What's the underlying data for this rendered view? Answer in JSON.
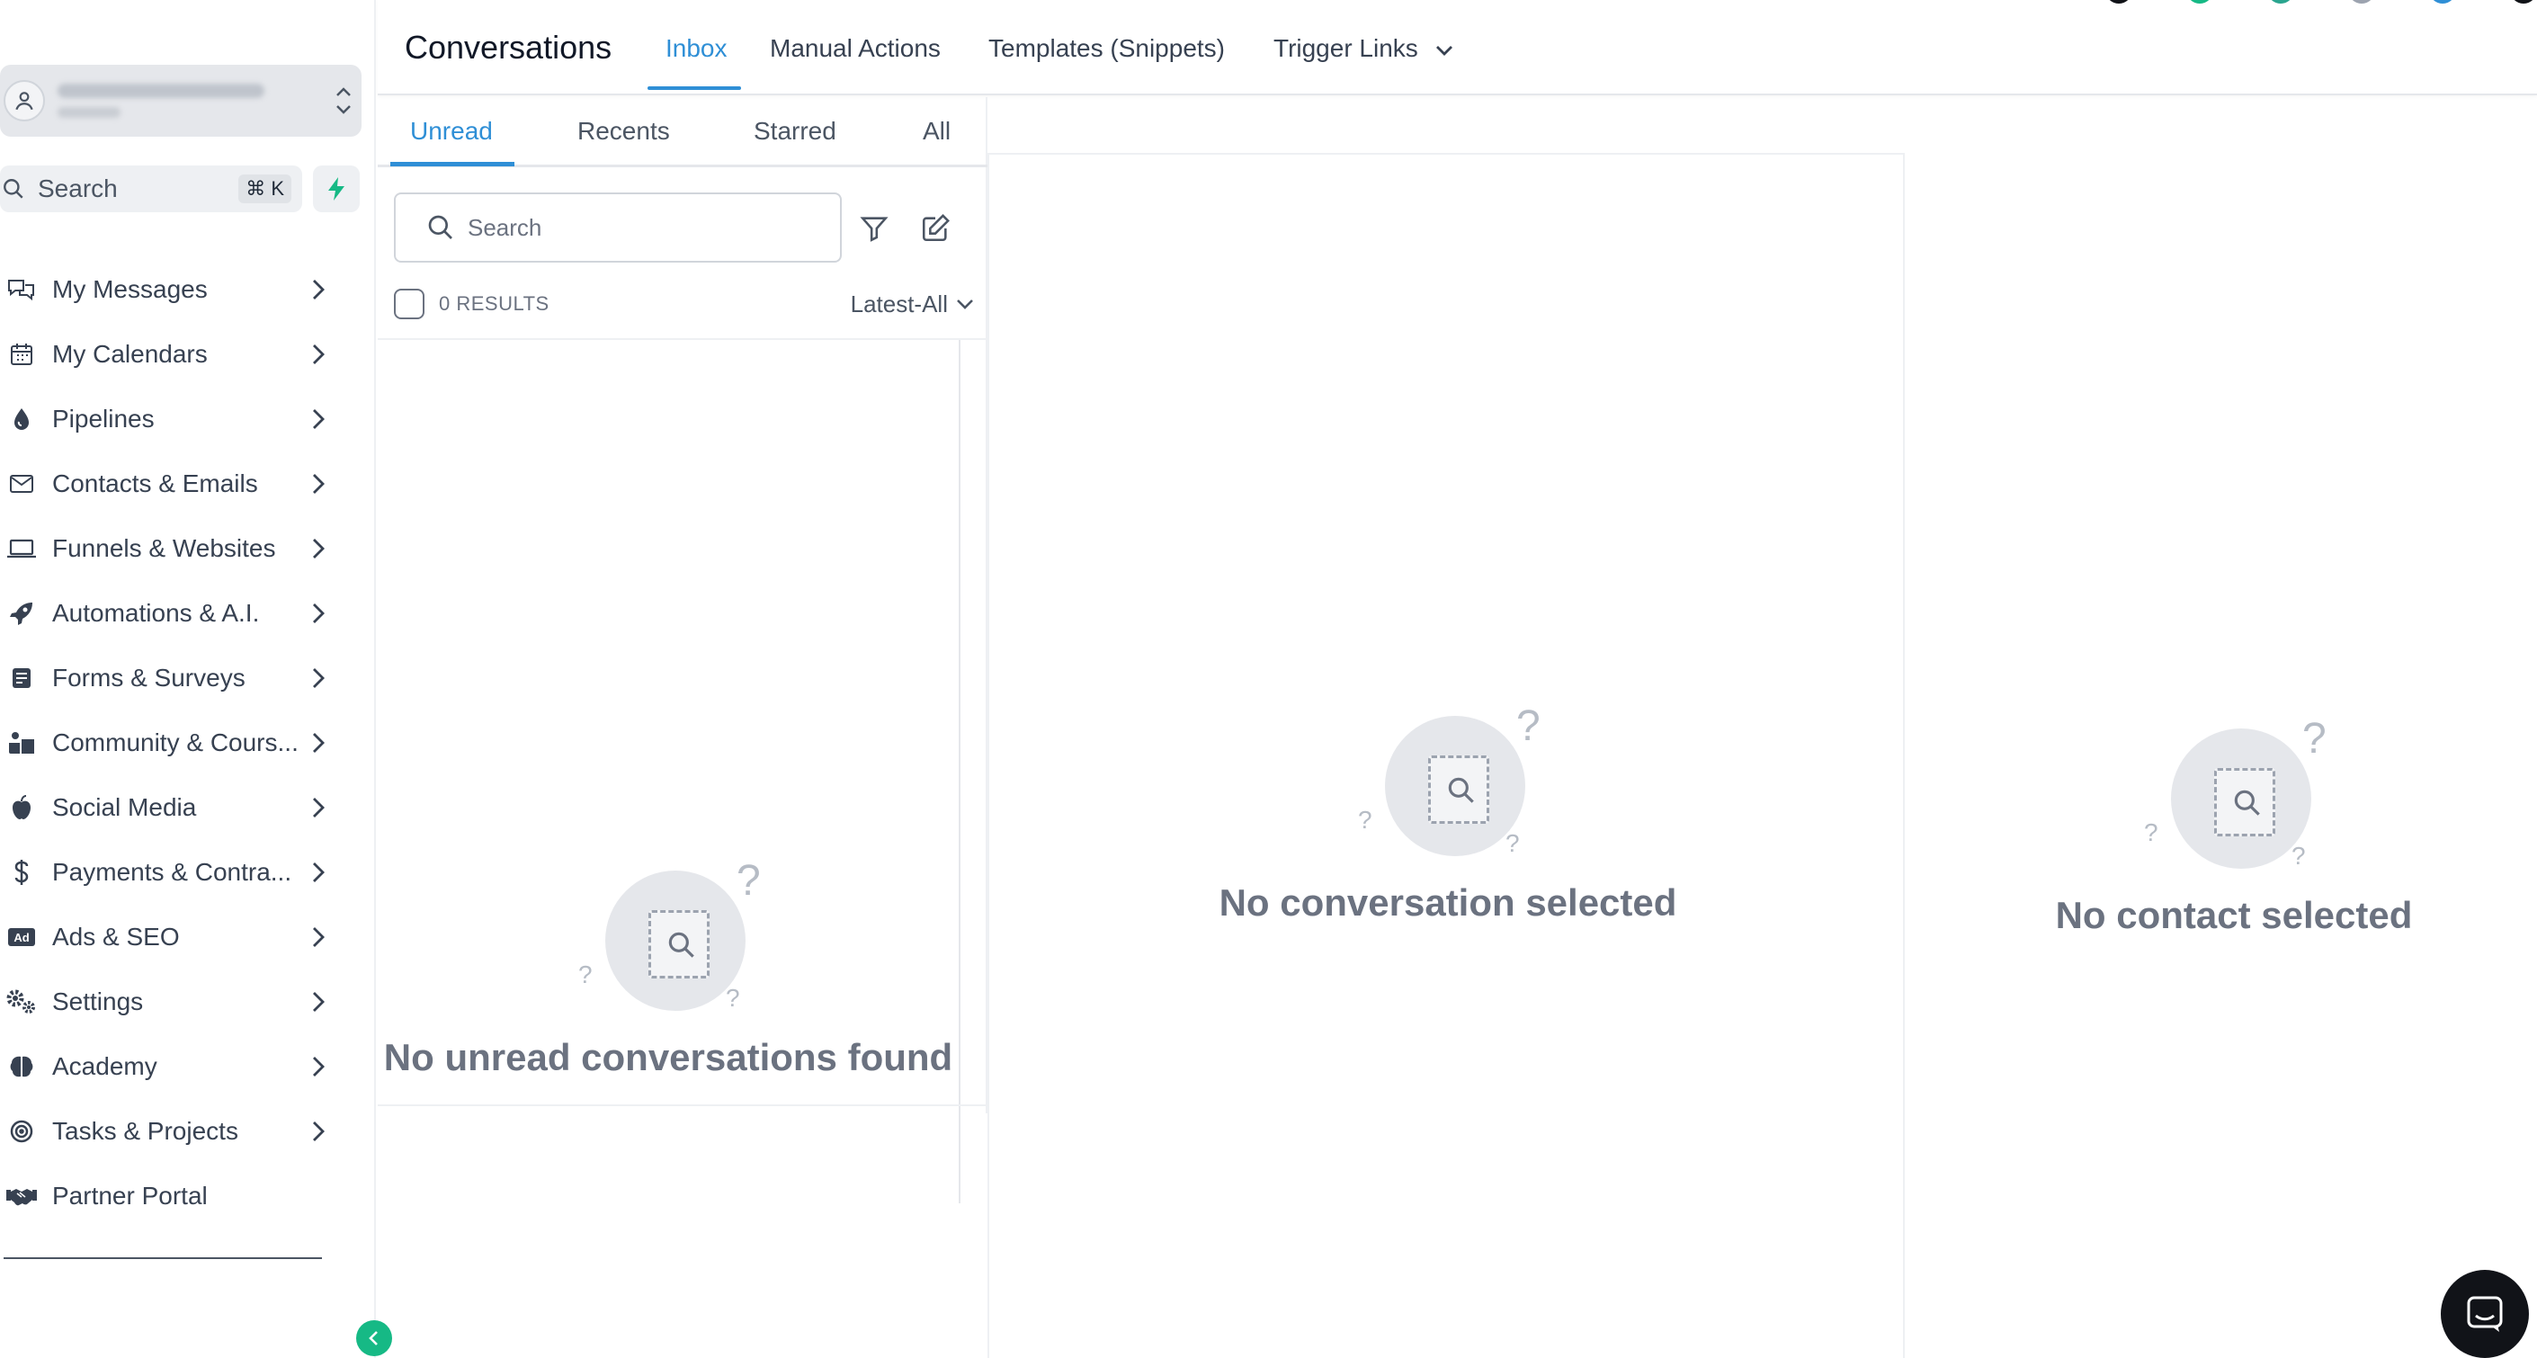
{
  "header": {
    "title": "Conversations",
    "tabs": [
      "Inbox",
      "Manual Actions",
      "Templates (Snippets)",
      "Trigger Links"
    ],
    "active_tab": "Inbox"
  },
  "sidebar": {
    "search_label": "Search",
    "search_shortcut": "⌘ K",
    "items": [
      {
        "label": "My Messages",
        "icon": "chat-icon",
        "has_arrow": true
      },
      {
        "label": "My Calendars",
        "icon": "calendar-icon",
        "has_arrow": true
      },
      {
        "label": "Pipelines",
        "icon": "drop-icon",
        "has_arrow": true
      },
      {
        "label": "Contacts & Emails",
        "icon": "mail-icon",
        "has_arrow": true
      },
      {
        "label": "Funnels & Websites",
        "icon": "laptop-icon",
        "has_arrow": true
      },
      {
        "label": "Automations & A.I.",
        "icon": "rocket-icon",
        "has_arrow": true
      },
      {
        "label": "Forms & Surveys",
        "icon": "form-icon",
        "has_arrow": true
      },
      {
        "label": "Community & Cours...",
        "icon": "book-icon",
        "has_arrow": true
      },
      {
        "label": "Social Media",
        "icon": "apple-icon",
        "has_arrow": true
      },
      {
        "label": "Payments & Contra...",
        "icon": "dollar-icon",
        "has_arrow": true
      },
      {
        "label": "Ads & SEO",
        "icon": "ad-icon",
        "has_arrow": true
      },
      {
        "label": "Settings",
        "icon": "gears-icon",
        "has_arrow": true
      },
      {
        "label": "Academy",
        "icon": "brain-icon",
        "has_arrow": true
      },
      {
        "label": "Tasks & Projects",
        "icon": "target-icon",
        "has_arrow": true
      },
      {
        "label": "Partner Portal",
        "icon": "handshake-icon",
        "has_arrow": false
      }
    ]
  },
  "list": {
    "tabs": [
      "Unread",
      "Recents",
      "Starred",
      "All"
    ],
    "active_tab": "Unread",
    "search_placeholder": "Search",
    "results": "0 RESULTS",
    "sort": "Latest-All",
    "empty_text": "No unread conversations found"
  },
  "middle": {
    "empty_text": "No conversation selected"
  },
  "right": {
    "empty_text": "No contact selected"
  },
  "colors": {
    "accent": "#2f8fd6",
    "green": "#16b985",
    "muted_text": "#6b7280"
  }
}
